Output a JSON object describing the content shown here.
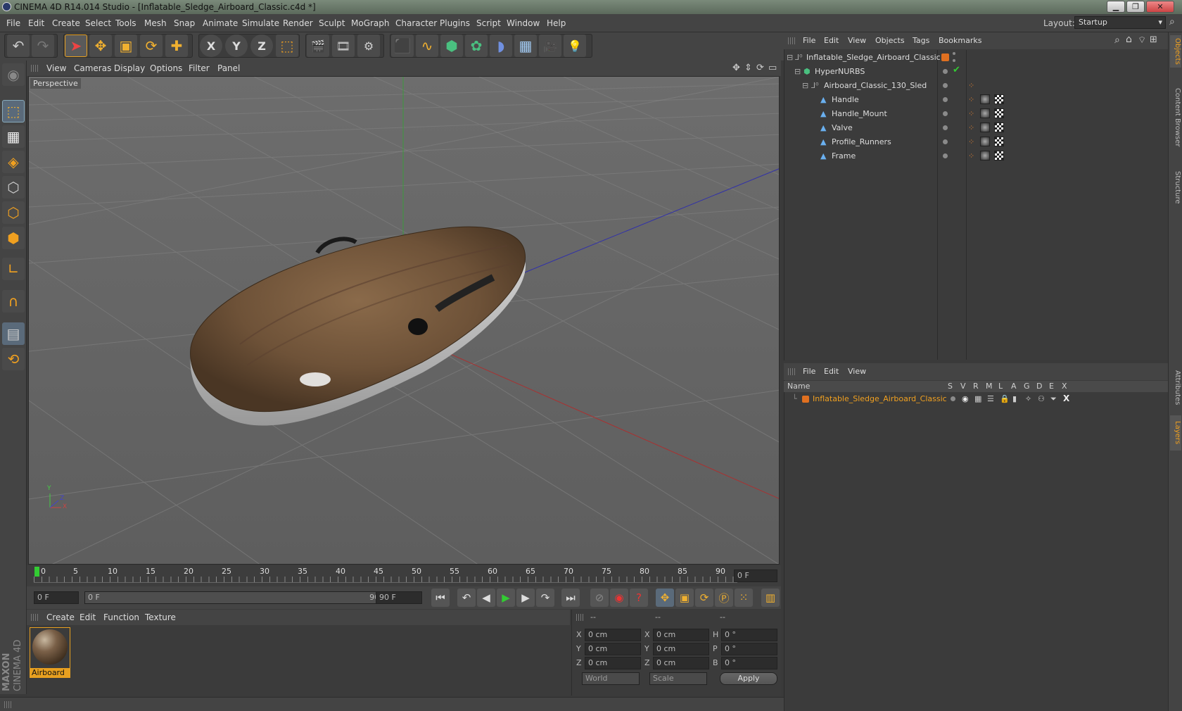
{
  "window": {
    "title": "CINEMA 4D R14.014 Studio - [Inflatable_Sledge_Airboard_Classic.c4d *]",
    "min": "▁",
    "restore": "❐",
    "close": "✕"
  },
  "menubar": {
    "items": [
      "File",
      "Edit",
      "Create",
      "Select",
      "Tools",
      "Mesh",
      "Snap",
      "Animate",
      "Simulate",
      "Render",
      "Sculpt",
      "MoGraph",
      "Character",
      "Plugins",
      "Script",
      "Window",
      "Help"
    ],
    "layout_label": "Layout:",
    "layout_value": "Startup"
  },
  "toolbar": {
    "undo": "↶",
    "redo": "↷",
    "select": "➤",
    "move": "✥",
    "scale": "▣",
    "rotate": "⟳",
    "add": "✚",
    "x": "X",
    "y": "Y",
    "z": "Z",
    "coord": "⬚",
    "render_view": "🎬",
    "render": "🎞",
    "render_settings": "⚙",
    "cube": "⬛",
    "spline": "∿",
    "nurbs": "⬢",
    "mograph": "✿",
    "deform": "◗",
    "scene": "▦",
    "camera": "🎥",
    "light": "💡"
  },
  "viewport": {
    "menu": [
      "View",
      "Cameras",
      "Display",
      "Options",
      "Filter",
      "Panel"
    ],
    "label": "Perspective",
    "axis_x": "X",
    "axis_y": "Y",
    "axis_z": "Z"
  },
  "timeline": {
    "ticks": [
      "0",
      "5",
      "10",
      "15",
      "20",
      "25",
      "30",
      "35",
      "40",
      "45",
      "50",
      "55",
      "60",
      "65",
      "70",
      "75",
      "80",
      "85",
      "90"
    ],
    "current_frame": "0 F",
    "start_field": "0 F",
    "range_start": "0 F",
    "range_end": "90 F",
    "end_field": "90 F"
  },
  "material_manager": {
    "menu": [
      "Create",
      "Edit",
      "Function",
      "Texture"
    ],
    "materials": [
      {
        "name": "Airboard"
      }
    ]
  },
  "coordinates": {
    "header": [
      "--",
      "--",
      "--"
    ],
    "rows": [
      {
        "a": "X",
        "av": "0 cm",
        "b": "X",
        "bv": "0 cm",
        "c": "H",
        "cv": "0 °"
      },
      {
        "a": "Y",
        "av": "0 cm",
        "b": "Y",
        "bv": "0 cm",
        "c": "P",
        "cv": "0 °"
      },
      {
        "a": "Z",
        "av": "0 cm",
        "b": "Z",
        "bv": "0 cm",
        "c": "B",
        "cv": "0 °"
      }
    ],
    "mode1": "World",
    "mode2": "Scale",
    "apply": "Apply"
  },
  "object_manager": {
    "menu": [
      "File",
      "Edit",
      "View",
      "Objects",
      "Tags",
      "Bookmarks"
    ],
    "objects": [
      {
        "name": "Inflatable_Sledge_Airboard_Classic",
        "indent": 0
      },
      {
        "name": "HyperNURBS",
        "indent": 1
      },
      {
        "name": "Airboard_Classic_130_Sled",
        "indent": 2
      },
      {
        "name": "Handle",
        "indent": 3
      },
      {
        "name": "Handle_Mount",
        "indent": 3
      },
      {
        "name": "Valve",
        "indent": 3
      },
      {
        "name": "Profile_Runners",
        "indent": 3
      },
      {
        "name": "Frame",
        "indent": 3
      }
    ]
  },
  "layer_manager": {
    "menu": [
      "File",
      "Edit",
      "View"
    ],
    "columns": {
      "name": "Name",
      "flags": [
        "S",
        "V",
        "R",
        "M",
        "L",
        "A",
        "G",
        "D",
        "E",
        "X"
      ]
    },
    "layers": [
      {
        "name": "Inflatable_Sledge_Airboard_Classic",
        "color": "#e07020"
      }
    ]
  },
  "side_tabs": [
    "Objects",
    "Content Browser",
    "Structure",
    "Attributes",
    "Layers"
  ],
  "brand": {
    "line1": "MAXON",
    "line2": "CINEMA 4D"
  },
  "colors": {
    "accent": "#e8a020",
    "selection": "#f0a020",
    "grid": "#7a7a7a"
  }
}
